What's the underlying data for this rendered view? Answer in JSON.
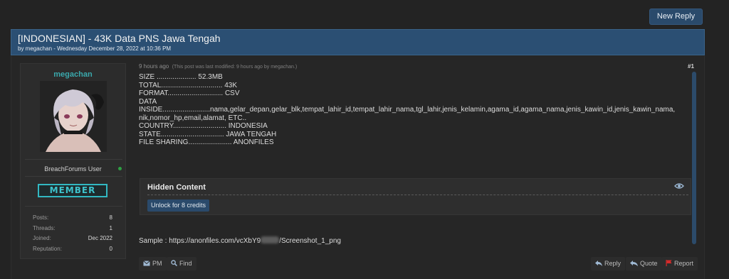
{
  "toolbar": {
    "new_reply_label": "New Reply"
  },
  "thread": {
    "title": "[INDONESIAN] - 43K Data PNS Jawa Tengah",
    "byline": "by megachan - Wednesday December 28, 2022 at 10:36 PM"
  },
  "author": {
    "name": "megachan",
    "user_title": "BreachForums User",
    "rank": "MEMBER",
    "online": true,
    "stats": [
      {
        "label": "Posts:",
        "value": "8"
      },
      {
        "label": "Threads:",
        "value": "1"
      },
      {
        "label": "Joined:",
        "value": "Dec 2022"
      },
      {
        "label": "Reputation:",
        "value": "0"
      }
    ]
  },
  "post": {
    "time": "9 hours ago",
    "modified": "(This post was last modified: 9 hours ago by megachan.)",
    "number": "#1",
    "lines": [
      "SIZE .................... 52.3MB",
      "TOTAL............................... 43K",
      "FORMAT............................ CSV",
      "DATA",
      "INSIDE........................nama,gelar_depan,gelar_blk,tempat_lahir_id,tempat_lahir_nama,tgl_lahir,jenis_kelamin,agama_id,agama_nama,jenis_kawin_id,jenis_kawin_nama,",
      "nik,nomor_hp,email,alamat, ETC..",
      "COUNTRY........................... INDONESIA",
      "STATE................................ JAWA TENGAH",
      "FILE SHARING...................... ANONFILES"
    ],
    "hidden_content": {
      "title": "Hidden Content",
      "unlock_label": "Unlock for 8 credits"
    },
    "sample_prefix": "Sample : ",
    "sample_link_start": "https://anonfiles.com/vcXbY9",
    "sample_link_end": "/Screenshot_1_png"
  },
  "actions": {
    "pm": "PM",
    "find": "Find",
    "reply": "Reply",
    "quote": "Quote",
    "report": "Report"
  },
  "colors": {
    "accent": "#2b4f73",
    "username": "#3aa8ac",
    "rank": "#32b8c2",
    "online": "#2ea043",
    "report_flag": "#d62a2a"
  }
}
